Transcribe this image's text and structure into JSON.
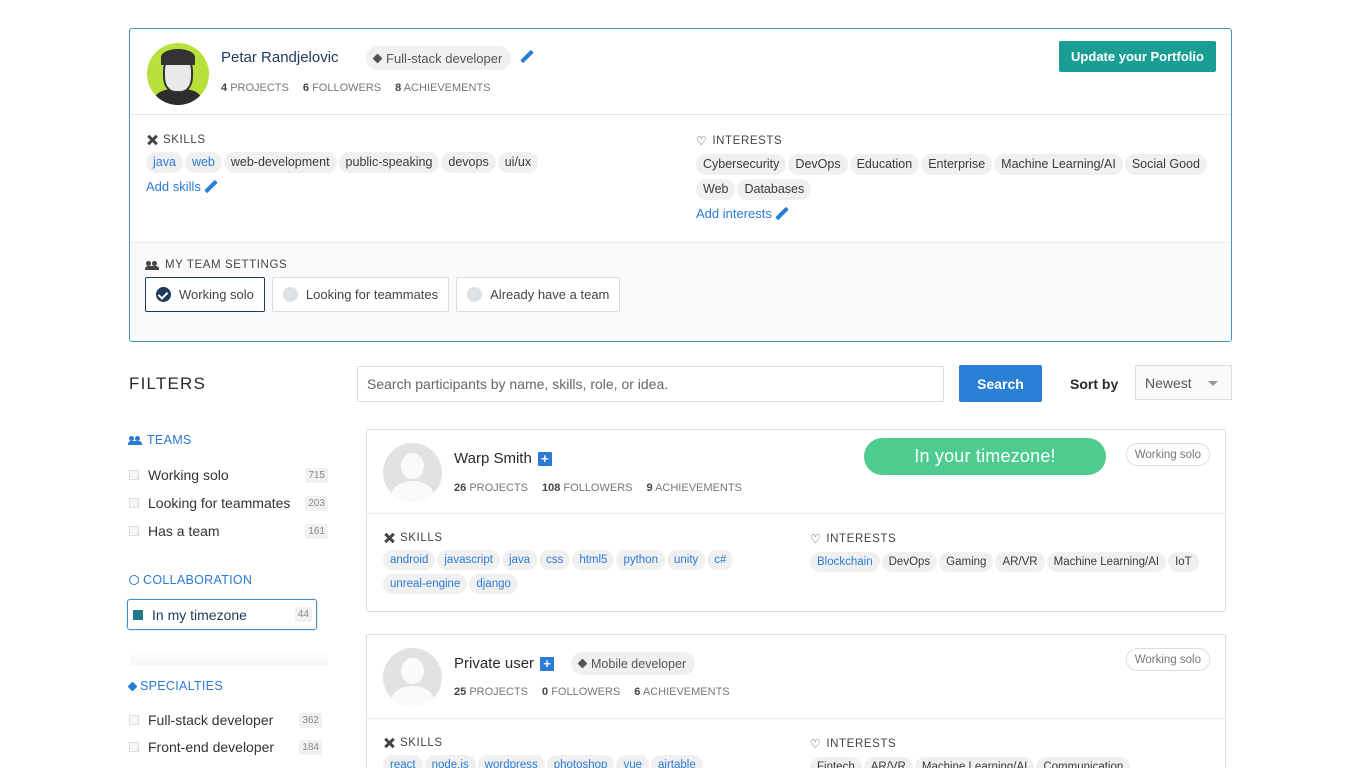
{
  "profile": {
    "name": "Petar Randjelovic",
    "role": "Full-stack developer",
    "stats": [
      {
        "value": "4",
        "label": "PROJECTS"
      },
      {
        "value": "6",
        "label": "FOLLOWERS"
      },
      {
        "value": "8",
        "label": "ACHIEVEMENTS"
      }
    ],
    "update_button": "Update your Portfolio",
    "skills_label": "SKILLS",
    "skills": [
      "java",
      "web",
      "web-development",
      "public-speaking",
      "devops",
      "ui/ux"
    ],
    "add_skills": "Add skills",
    "interests_label": "INTERESTS",
    "interests": [
      "Cybersecurity",
      "DevOps",
      "Education",
      "Enterprise",
      "Machine Learning/AI",
      "Social Good",
      "Web",
      "Databases"
    ],
    "add_interests": "Add interests",
    "team_settings_label": "MY TEAM SETTINGS",
    "team_options": [
      {
        "label": "Working solo",
        "selected": true
      },
      {
        "label": "Looking for teammates",
        "selected": false
      },
      {
        "label": "Already have a team",
        "selected": false
      }
    ]
  },
  "filters": {
    "title": "FILTERS",
    "teams": {
      "label": "TEAMS",
      "items": [
        {
          "label": "Working solo",
          "count": "715"
        },
        {
          "label": "Looking for teammates",
          "count": "203"
        },
        {
          "label": "Has a team",
          "count": "161"
        }
      ]
    },
    "collaboration": {
      "label": "COLLABORATION",
      "items": [
        {
          "label": "In my timezone",
          "count": "44",
          "checked": true
        }
      ]
    },
    "specialties": {
      "label": "SPECIALTIES",
      "items": [
        {
          "label": "Full-stack developer",
          "count": "362"
        },
        {
          "label": "Front-end developer",
          "count": "184"
        }
      ]
    }
  },
  "search": {
    "placeholder": "Search participants by name, skills, role, or idea.",
    "button": "Search",
    "sort_label": "Sort by",
    "sort_value": "Newest"
  },
  "participants": [
    {
      "name": "Warp Smith",
      "role": "",
      "stats": [
        {
          "value": "26",
          "label": "PROJECTS"
        },
        {
          "value": "108",
          "label": "FOLLOWERS"
        },
        {
          "value": "9",
          "label": "ACHIEVEMENTS"
        }
      ],
      "timezone_badge": "In your timezone!",
      "status": "Working solo",
      "skills_label": "SKILLS",
      "skills": [
        "android",
        "javascript",
        "java",
        "css",
        "html5",
        "python",
        "unity",
        "c#",
        "unreal-engine",
        "django"
      ],
      "interests_label": "INTERESTS",
      "interests": [
        "Blockchain",
        "DevOps",
        "Gaming",
        "AR/VR",
        "Machine Learning/AI",
        "IoT"
      ]
    },
    {
      "name": "Private user",
      "role": "Mobile developer",
      "stats": [
        {
          "value": "25",
          "label": "PROJECTS"
        },
        {
          "value": "0",
          "label": "FOLLOWERS"
        },
        {
          "value": "6",
          "label": "ACHIEVEMENTS"
        }
      ],
      "status": "Working solo",
      "skills_label": "SKILLS",
      "skills": [
        "react",
        "node.js",
        "wordpress",
        "photoshop",
        "vue",
        "airtable"
      ],
      "interests_label": "INTERESTS",
      "interests": [
        "Fintech",
        "AR/VR",
        "Machine Learning/AI",
        "Communication"
      ]
    }
  ],
  "colors": {
    "accent_teal": "#1a9e93",
    "link_blue": "#2a7bd6",
    "timezone_green": "#4ecb8f",
    "border_blue": "#4a90c8"
  }
}
